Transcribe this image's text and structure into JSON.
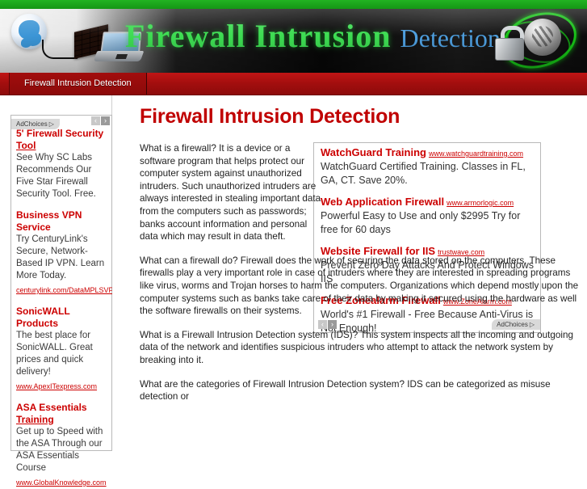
{
  "site": {
    "banner_title_main": "Firewall Intrusion",
    "banner_title_sub": "Detection",
    "nav_tab": "Firewall Intrusion Detection",
    "accent_red": "#cc0000",
    "accent_green": "#3ddc52",
    "accent_blue": "#4d9ede",
    "nav_bg": "#a20e0e"
  },
  "page": {
    "title": "Firewall Intrusion Detection"
  },
  "sidebar_ads": {
    "adchoices_label": "AdChoices",
    "adchoices_glyph": "▷",
    "prev_glyph": "‹",
    "next_glyph": "›",
    "items": [
      {
        "title": "5' Firewall Security Tool",
        "title_part1": "5' Firewall Security ",
        "title_part2": "Tool",
        "desc": "See Why SC Labs Recommends Our Five Star Firewall Security Tool. Free.",
        "url": ""
      },
      {
        "title": "Business VPN Service",
        "desc": "Try CenturyLink's Secure, Network- Based IP VPN. Learn More Today.",
        "url": "centurylink.com/DataMPLSVPN"
      },
      {
        "title": "SonicWALL Products",
        "desc": "The best place for SonicWALL. Great prices and quick delivery!",
        "url": "www.ApexITexpress.com"
      },
      {
        "title": "ASA Essentials Training",
        "title_part1": "ASA Essentials ",
        "title_part2": "Training",
        "desc": "Get up to Speed with the ASA Through our ASA Essentials Course",
        "url": "www.GlobalKnowledge.com"
      }
    ]
  },
  "content_ads": {
    "adchoices_label": "AdChoices",
    "adchoices_glyph": "▷",
    "prev_glyph": "‹",
    "next_glyph": "›",
    "items": [
      {
        "title": "WatchGuard Training",
        "url": "www.watchguardtraining.com",
        "desc": "WatchGuard Certified Training. Classes in FL, GA, CT. Save 20%."
      },
      {
        "title": "Web Application Firewall",
        "url": "www.armorlogic.com",
        "desc": "Powerful Easy to Use and only $2995 Try for free for 60 days"
      },
      {
        "title": "Website Firewall for IIS",
        "url": "trustwave.com",
        "desc": "Prevent Zero Day Attacks And Protect Windows IIS"
      },
      {
        "title": "Free Zonealarm Firewall",
        "url": "www.ZoneAlarm.com",
        "desc": "World's #1 Firewall - Free Because Anti-Virus is Not Enough!"
      }
    ]
  },
  "article": {
    "paragraphs": [
      "What is a firewall? It is a device or a software program that helps protect our computer system against unauthorized intruders. Such unauthorized intruders are always interested in stealing important data from the computers such as passwords; banks account information and personal data which may result in data theft.",
      "What can a firewall do? Firewall does the work of securing the data stored on the computers. These firewalls play a very important role in case of intruders where they are interested in spreading programs like virus, worms and Trojan horses to harm the computers. Organizations which depend mostly upon the computer systems such as banks take care of their data by making it secured using the hardware as well the software firewalls on their systems.",
      "What is a Firewall Intrusion Detection system (IDS)? This system inspects all the incoming and outgoing data of the network and identifies suspicious intruders who attempt to attack the network system by breaking into it.",
      "What are the categories of Firewall Intrusion Detection system? IDS can be categorized as misuse detection or"
    ]
  }
}
